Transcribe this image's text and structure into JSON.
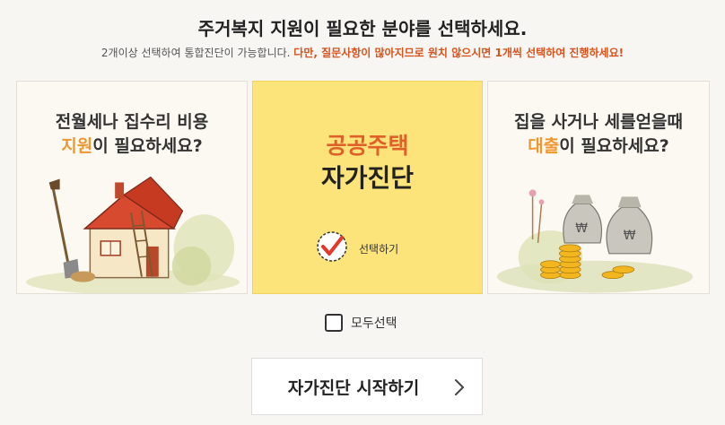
{
  "header": {
    "title": "주거복지 지원이 필요한 분야를 선택하세요.",
    "subtitle_normal": "2개이상 선택하여 통합진단이 가능합니다. ",
    "subtitle_warning": "다만, 질문사항이 많아지므로 원치 않으시면 1개씩 선택하여 진행하세요!"
  },
  "cards": {
    "left": {
      "line1": "전월세나 집수리 비용",
      "line2_highlight": "지원",
      "line2_rest": "이 필요하세요?",
      "icon": "house-illustration-icon"
    },
    "middle": {
      "title_line1": "공공주택",
      "title_line2": "자가진단",
      "check_label": "선택하기",
      "icon": "checkmark-badge-icon"
    },
    "right": {
      "line1": "집을 사거나 세를얻을때",
      "line2_highlight": "대출",
      "line2_rest": "이 필요하세요?",
      "icon": "money-bags-illustration-icon"
    }
  },
  "select_all": {
    "label": "모두선택",
    "checked": false
  },
  "start_button": {
    "label": "자가진단 시작하기"
  },
  "colors": {
    "background": "#f7f6f2",
    "highlight_orange": "#f0962e",
    "warning_text": "#d9531e",
    "selected_card": "#fde47a",
    "check_red": "#e23a2a"
  }
}
